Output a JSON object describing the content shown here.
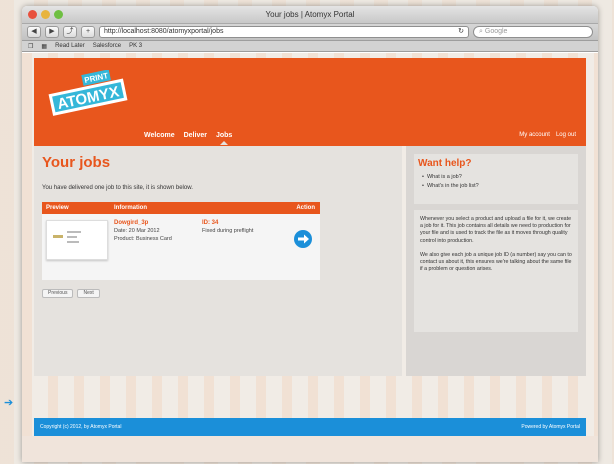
{
  "window": {
    "title": "Your jobs | Atomyx Portal"
  },
  "toolbar": {
    "url": "http://localhost:8080/atomyxportal/jobs",
    "search_placeholder": "Google"
  },
  "bookmarks": [
    "Read Later",
    "Salesforce",
    "PK 3"
  ],
  "brand": {
    "logo_top": "PRINT",
    "logo_main": "ATOMYX"
  },
  "nav": {
    "items": [
      "Welcome",
      "Deliver",
      "Jobs"
    ],
    "active": "Jobs"
  },
  "account": {
    "my_account": "My account",
    "logout": "Log out"
  },
  "main": {
    "title": "Your jobs",
    "intro": "You have delivered one job to this site, it is shown below.",
    "columns": {
      "preview": "Preview",
      "information": "Information",
      "action": "Action"
    },
    "job": {
      "name": "Dowgird_3p",
      "date": "Date: 20 Mar 2012",
      "product": "Product: Business Card",
      "id_label": "ID: 34",
      "status": "Fixed during preflight"
    },
    "buttons": [
      "Previous",
      "Next"
    ]
  },
  "help": {
    "title": "Want help?",
    "links": [
      "What is a job?",
      "What's in the job list?"
    ],
    "paragraphs": [
      "Whenever you select a product and upload a file for it, we create a job for it. This job contains all details we need to production for your file and is used to track the file as it moves through quality control into production.",
      "We also give each job a unique job ID (a number) say you can to contact us about it, this ensures we're talking about the same file if a problem or question arises."
    ]
  },
  "footer": {
    "copyright": "Copyright (c) 2012, by Atomyx Portal",
    "powered": "Powered by Atomyx Portal"
  },
  "colors": {
    "accent": "#e8561d",
    "footer": "#1b8fd9"
  }
}
